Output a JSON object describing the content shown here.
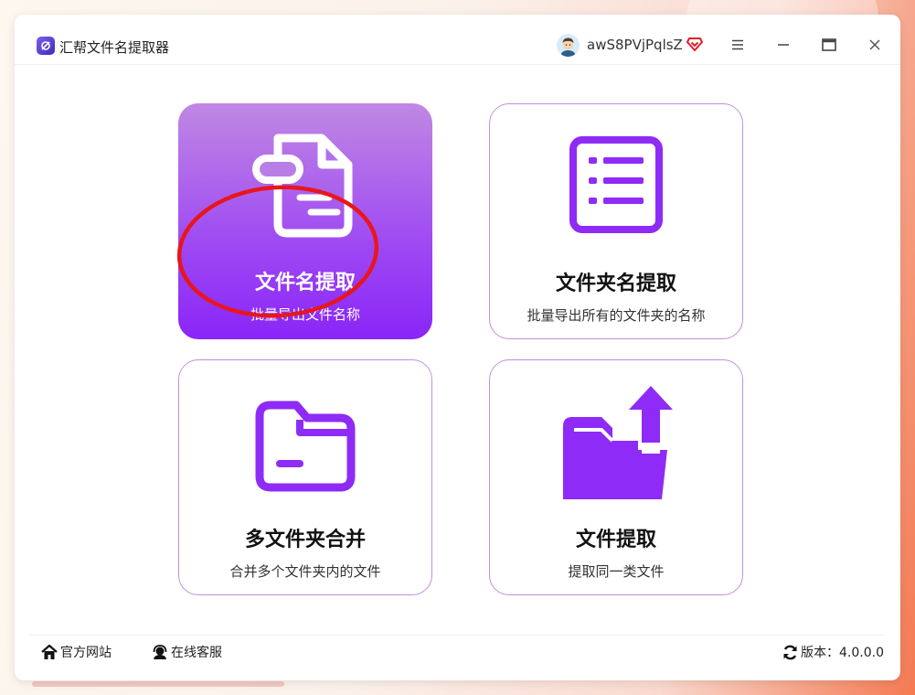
{
  "app": {
    "title": "汇帮文件名提取器"
  },
  "user": {
    "name": "awS8PVjPqlsZ"
  },
  "icons": {
    "app_logo": "app-logo-icon",
    "avatar": "user-avatar-icon",
    "vip": "vip-diamond-icon",
    "menu": "hamburger-icon",
    "minimize": "minimize-icon",
    "maximize": "maximize-icon",
    "close": "close-icon",
    "home": "home-icon",
    "service": "headset-icon",
    "refresh": "refresh-icon"
  },
  "colors": {
    "accent": "#8f2bf6",
    "card_border": "#c18fe0",
    "highlight_ring": "#e8161b"
  },
  "cards": [
    {
      "title": "文件名提取",
      "desc": "批量导出文件名称",
      "icon": "file-document-icon",
      "active": true
    },
    {
      "title": "文件夹名提取",
      "desc": "批量导出所有的文件夹的名称",
      "icon": "list-icon",
      "active": false
    },
    {
      "title": "多文件夹合并",
      "desc": "合并多个文件夹内的文件",
      "icon": "folder-icon",
      "active": false
    },
    {
      "title": "文件提取",
      "desc": "提取同一类文件",
      "icon": "folder-upload-icon",
      "active": false
    }
  ],
  "footer": {
    "website": "官方网站",
    "service": "在线客服",
    "version": "版本：4.0.0.0"
  }
}
